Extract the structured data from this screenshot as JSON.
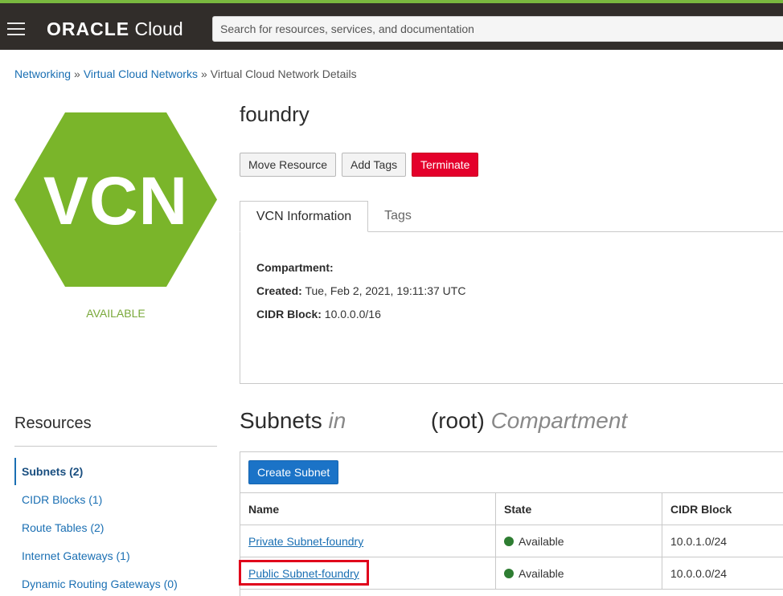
{
  "header": {
    "brand_bold": "ORACLE",
    "brand_light": "Cloud",
    "search_placeholder": "Search for resources, services, and documentation"
  },
  "breadcrumb": {
    "items": [
      "Networking",
      "Virtual Cloud Networks",
      "Virtual Cloud Network Details"
    ],
    "separator": "»"
  },
  "vcn": {
    "icon_text": "VCN",
    "status": "AVAILABLE",
    "icon_color": "#7ab52a",
    "name": "foundry"
  },
  "actions": {
    "move": "Move Resource",
    "add_tags": "Add Tags",
    "terminate": "Terminate"
  },
  "tabs": [
    "VCN Information",
    "Tags"
  ],
  "info": {
    "compartment_label": "Compartment:",
    "compartment_value": "",
    "created_label": "Created:",
    "created_value": "Tue, Feb 2, 2021, 19:11:37 UTC",
    "cidr_label": "CIDR Block:",
    "cidr_value": "10.0.0.0/16"
  },
  "resources": {
    "title": "Resources",
    "items": [
      "Subnets (2)",
      "CIDR Blocks (1)",
      "Route Tables (2)",
      "Internet Gateways (1)",
      "Dynamic Routing Gateways (0)"
    ]
  },
  "subnets": {
    "title_main": "Subnets",
    "title_in": "in",
    "title_root": "(root)",
    "title_compartment": "Compartment",
    "create_button": "Create Subnet",
    "columns": [
      "Name",
      "State",
      "CIDR Block"
    ],
    "rows": [
      {
        "name": "Private Subnet-foundry",
        "state": "Available",
        "cidr": "10.0.1.0/24"
      },
      {
        "name": "Public Subnet-foundry",
        "state": "Available",
        "cidr": "10.0.0.0/24"
      }
    ]
  },
  "colors": {
    "topbar": "#312d2a",
    "accent_green": "#79b83f",
    "link_blue": "#1a6fb3",
    "terminate_red": "#e4002b",
    "available_green": "#2e7d32",
    "highlight_red": "#e0001b"
  }
}
